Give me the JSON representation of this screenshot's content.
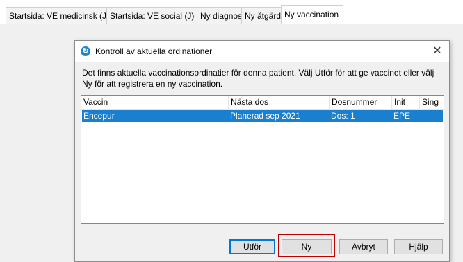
{
  "tabs": [
    {
      "label": "Startsida: VE medicinsk (J)"
    },
    {
      "label": "Startsida: VE social (J)"
    },
    {
      "label": "Ny diagnos"
    },
    {
      "label": "Ny åtgärd"
    },
    {
      "label": "Ny vaccination"
    }
  ],
  "dialog": {
    "title": "Kontroll av aktuella ordinationer",
    "icon": "refresh-icon",
    "close_label": "✕",
    "message": "Det finns aktuella vaccinationsordinatier för denna patient. Välj Utför för att ge vaccinet eller välj Ny för att registrera en ny vaccination.",
    "columns": [
      "Vaccin",
      "Nästa dos",
      "Dosnummer",
      "Init",
      "Sing"
    ],
    "rows": [
      {
        "vaccin": "Encepur",
        "nasta_dos": "Planerad sep 2021",
        "dosnummer": "Dos: 1",
        "init": "EPE",
        "sing": ""
      }
    ],
    "buttons": {
      "utfor": "Utför",
      "ny": "Ny",
      "avbryt": "Avbryt",
      "hjalp": "Hjälp"
    }
  },
  "colors": {
    "selection": "#1b7fd0",
    "highlight_box": "#c00000",
    "default_button_border": "#0078d7"
  }
}
